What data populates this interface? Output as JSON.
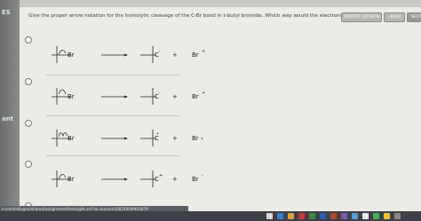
{
  "sidebar": {
    "label_top": "ES",
    "label_mid": "ant"
  },
  "question": {
    "text": "Give the proper arrow notation for the homolytic cleavage of the C-Br bond in t-butyl bromide. Which way would the electrons really go?"
  },
  "buttons": {
    "print": "PRINTER VERSION",
    "back": "‹ BACK",
    "next": "NEXT ›"
  },
  "options": [
    {
      "reactant_label": "Br",
      "product_label": "C",
      "product_charge": "-",
      "plus": "+",
      "br_product": "Br",
      "br_charge": "+"
    },
    {
      "reactant_label": "Br",
      "product_label": "C",
      "product_charge": "-",
      "plus": "+",
      "br_product": "Br",
      "br_charge": "+"
    },
    {
      "reactant_label": "Br",
      "product_label": "C",
      "product_charge": "•",
      "plus": "+",
      "br_product": "Br",
      "br_charge": "•"
    },
    {
      "reactant_label": "Br",
      "product_label": "C",
      "product_charge": "+",
      "plus": "+",
      "br_product": "Br",
      "br_charge": "-"
    }
  ],
  "status": {
    "url": "e.com/ed/ugen/shared/assignment/test/agAt.uni?id=auvxnn1682400#N10079"
  },
  "colors": {
    "page_bg": "#ecebe6",
    "text": "#3c3c3c"
  }
}
